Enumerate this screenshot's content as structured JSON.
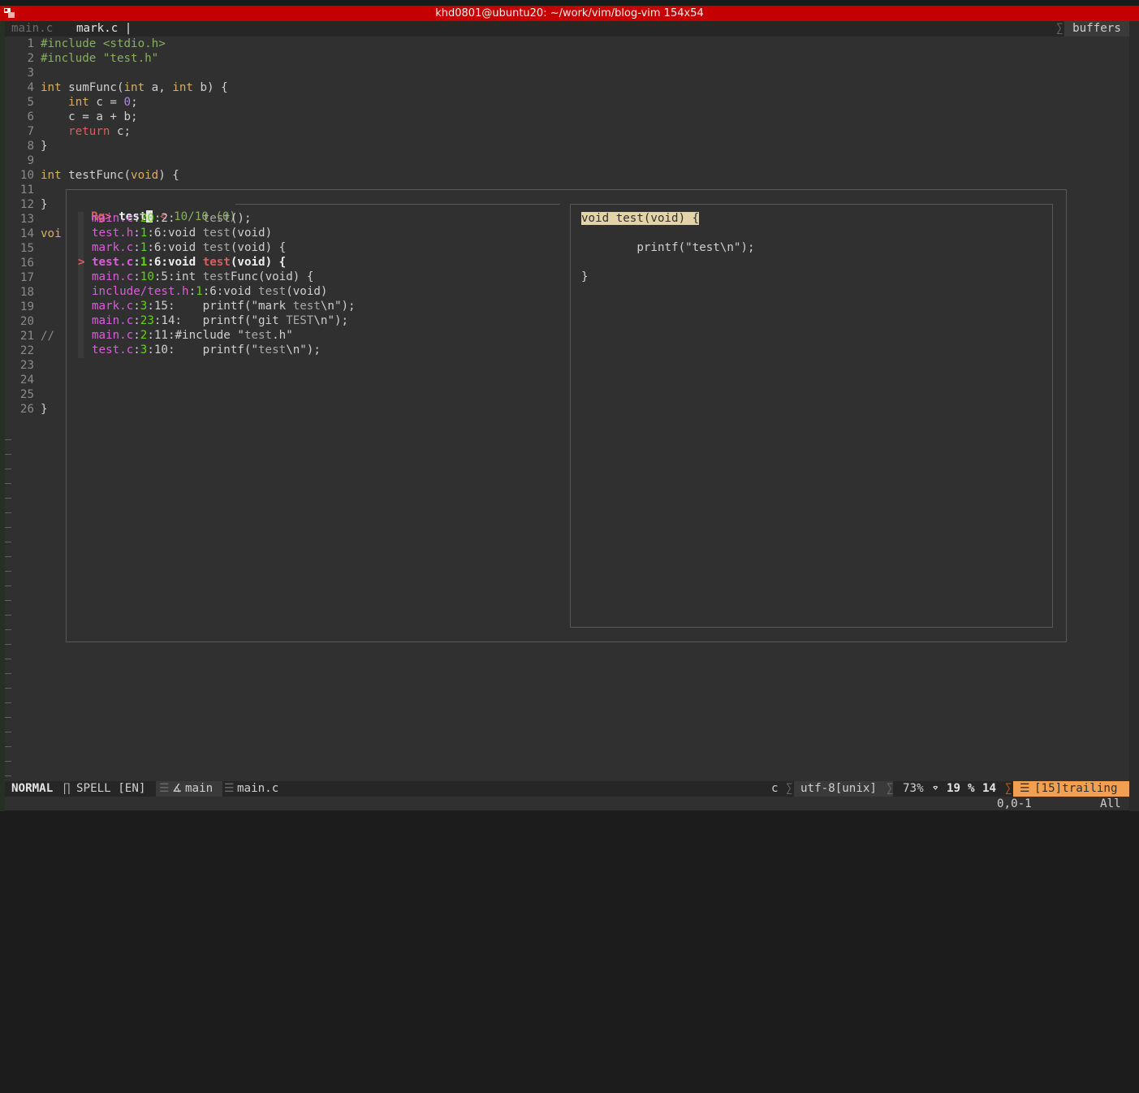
{
  "window": {
    "title": "khd0801@ubuntu20: ~/work/vim/blog-vim 154x54"
  },
  "tabline": {
    "tabs": [
      "main.c",
      "mark.c |"
    ],
    "right_label": "buffers"
  },
  "editor": {
    "line_numbers": [
      "1",
      "2",
      "3",
      "4",
      "5",
      "6",
      "7",
      "8",
      "9",
      "10",
      "11",
      "12",
      "13",
      "14",
      "15",
      "16",
      "17",
      "18",
      "19",
      "20",
      "21",
      "22",
      "23",
      "24",
      "25",
      "26"
    ],
    "lines": {
      "l1a": "#include",
      "l1b": " <stdio.h>",
      "l2a": "#include",
      "l2b": " \"test.h\"",
      "l4a": "int",
      "l4b": " sumFunc(",
      "l4c": "int",
      "l4d": " a, ",
      "l4e": "int",
      "l4f": " b) {",
      "l5a": "    ",
      "l5b": "int",
      "l5c": " c = ",
      "l5d": "0",
      "l5e": ";",
      "l6": "    c = a + b;",
      "l7a": "    ",
      "l7b": "return",
      "l7c": " c;",
      "l8": "}",
      "l10a": "int",
      "l10b": " testFunc(",
      "l10c": "void",
      "l10d": ") {",
      "l12": "}",
      "l14": "voi",
      "l21": "//",
      "l26": "}"
    }
  },
  "fzf": {
    "prompt": "Rg>",
    "query": "test",
    "marker": "<",
    "count": "10/10 (0)",
    "results": [
      {
        "file": "main.c",
        "line": "20",
        "rest": ":2:    ",
        "match": "test",
        "tail": "();"
      },
      {
        "file": "test.h",
        "line": "1",
        "rest": ":6:void ",
        "match": "test",
        "tail": "(void)"
      },
      {
        "file": "mark.c",
        "line": "1",
        "rest": ":6:void ",
        "match": "test",
        "tail": "(void) {"
      },
      {
        "file": "test.c",
        "line": "1",
        "rest": ":6:void ",
        "match": "test",
        "tail": "(void) {"
      },
      {
        "file": "main.c",
        "line": "10",
        "rest": ":5:int ",
        "match": "test",
        "tail": "Func(void) {"
      },
      {
        "file": "include/test.h",
        "line": "1",
        "rest": ":6:void ",
        "match": "test",
        "tail": "(void)"
      },
      {
        "file": "mark.c",
        "line": "3",
        "rest": ":15:    printf(\"mark ",
        "match": "test",
        "tail": "\\n\");"
      },
      {
        "file": "main.c",
        "line": "23",
        "rest": ":14:   printf(\"git ",
        "match": "TEST",
        "tail": "\\n\");"
      },
      {
        "file": "main.c",
        "line": "2",
        "rest": ":11:#include \"",
        "match": "test",
        "tail": ".h\""
      },
      {
        "file": "test.c",
        "line": "3",
        "rest": ":10:    printf(\"",
        "match": "test",
        "tail": "\\n\");"
      }
    ],
    "selected_pointer": ">",
    "preview": {
      "line1": "void test(void) {",
      "line2": "        printf(\"test\\n\");",
      "line3": "}"
    }
  },
  "statusline": {
    "mode": "NORMAL",
    "spell": "SPELL [EN]",
    "branch": "main",
    "file": "main.c",
    "filetype": "c",
    "encoding": "utf-8[unix]",
    "percent": "73%",
    "line": "19",
    "col": "14",
    "warning": "[15]trailing",
    "cmd_pos": "0,0-1",
    "cmd_all": "All"
  },
  "colors": {
    "titlebar": "#c40000",
    "editor_bg": "#303030",
    "warning_bg": "#f0a050"
  }
}
